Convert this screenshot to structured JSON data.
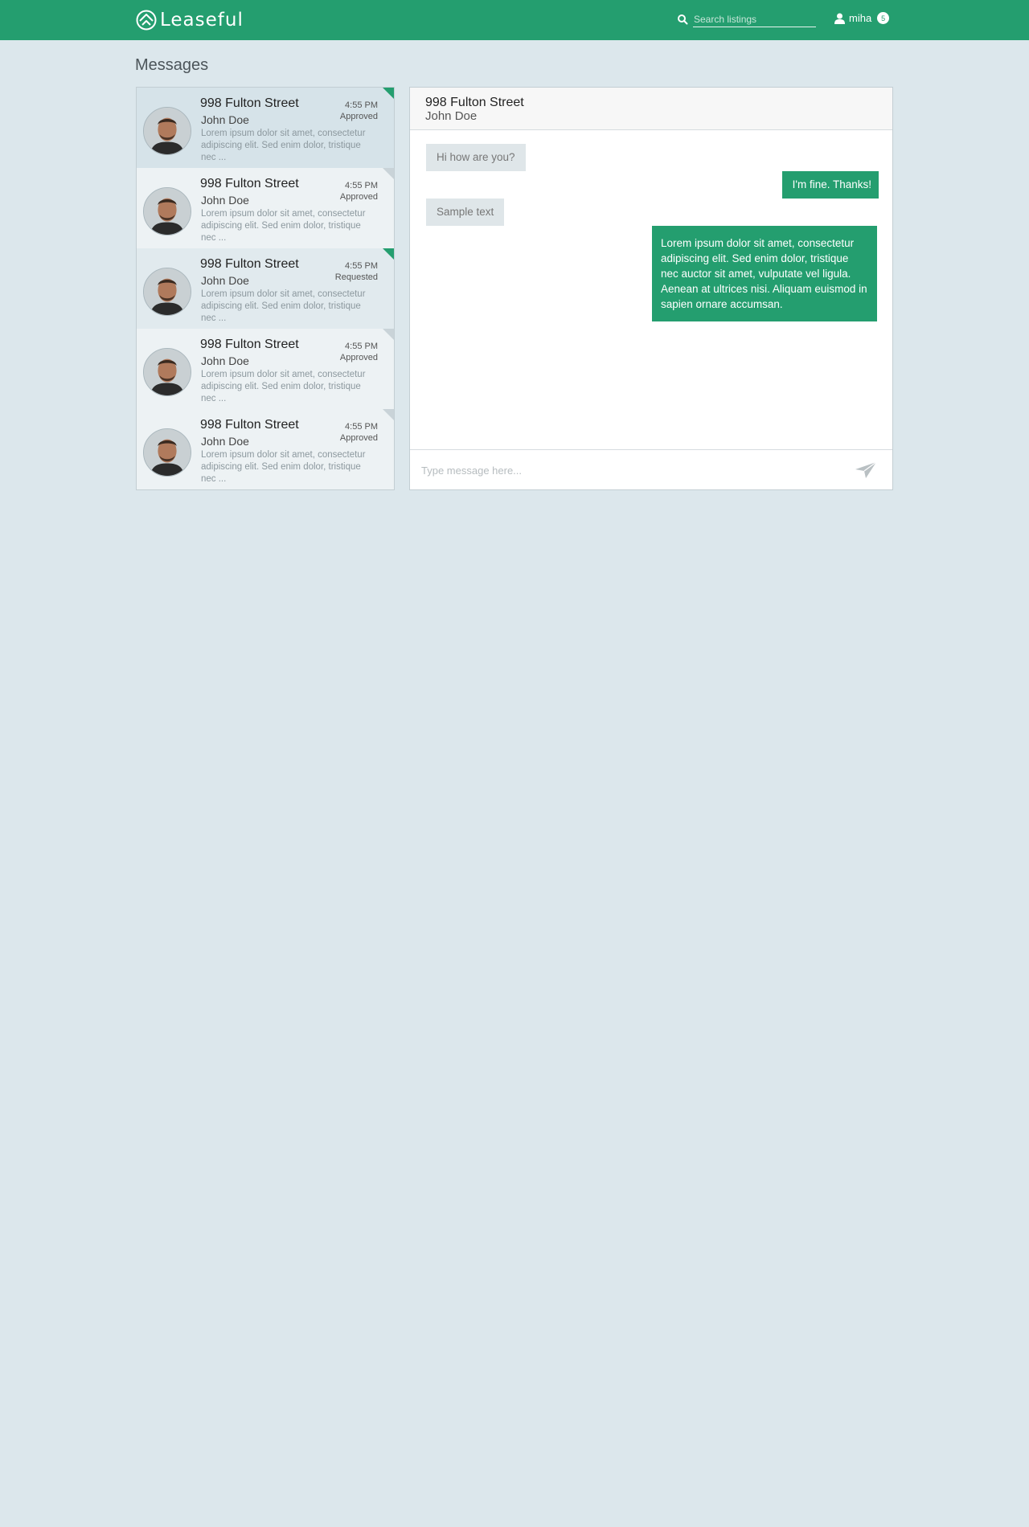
{
  "header": {
    "logo_text": "Leaseful",
    "search_placeholder": "Search listings",
    "user_name": "miha",
    "notification_count": "5"
  },
  "page": {
    "title": "Messages"
  },
  "conversations": [
    {
      "title": "998 Fulton Street",
      "name": "John Doe",
      "preview": "Lorem ipsum dolor sit amet, consectetur adipiscing elit. Sed enim dolor, tristique nec ...",
      "time": "4:55 PM",
      "status": "Approved"
    },
    {
      "title": "998 Fulton Street",
      "name": "John Doe",
      "preview": "Lorem ipsum dolor sit amet, consectetur adipiscing elit. Sed enim dolor, tristique nec ...",
      "time": "4:55 PM",
      "status": "Approved"
    },
    {
      "title": "998 Fulton Street",
      "name": "John Doe",
      "preview": "Lorem ipsum dolor sit amet, consectetur adipiscing elit. Sed enim dolor, tristique nec ...",
      "time": "4:55 PM",
      "status": "Requested"
    },
    {
      "title": "998 Fulton Street",
      "name": "John Doe",
      "preview": "Lorem ipsum dolor sit amet, consectetur adipiscing elit. Sed enim dolor, tristique nec ...",
      "time": "4:55 PM",
      "status": "Approved"
    },
    {
      "title": "998 Fulton Street",
      "name": "John Doe",
      "preview": "Lorem ipsum dolor sit amet, consectetur adipiscing elit. Sed enim dolor, tristique nec ...",
      "time": "4:55 PM",
      "status": "Approved"
    }
  ],
  "chat": {
    "title": "998 Fulton Street",
    "subtitle": "John Doe",
    "messages": [
      {
        "text": "Hi how are you?"
      },
      {
        "text": "I'm fine. Thanks!"
      },
      {
        "text": "Sample text"
      },
      {
        "text": "Lorem ipsum dolor sit amet, consectetur adipiscing elit. Sed enim dolor, tristique nec auctor sit amet, vulputate vel ligula. Aenean at ultrices nisi. Aliquam euismod in sapien ornare accumsan."
      }
    ],
    "input_placeholder": "Type message here..."
  },
  "colors": {
    "brand": "#249e6f",
    "background": "#dce7ec"
  },
  "icons": {
    "search": "search-icon",
    "user": "user-icon",
    "send": "send-icon",
    "logo": "home-logo-icon"
  }
}
